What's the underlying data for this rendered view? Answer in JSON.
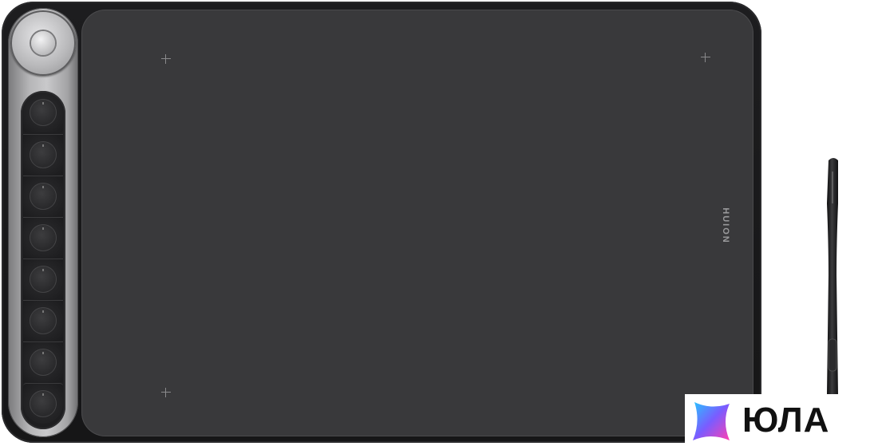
{
  "product": {
    "brand_mark": "HUION",
    "express_keys": 8
  },
  "watermark": {
    "text": "ЮЛА"
  },
  "colors": {
    "tablet_body": "#1d1d1f",
    "active_area": "#39393b",
    "side_panel": "#b5b5b7",
    "watermark_gradient_start": "#27c4ff",
    "watermark_gradient_end": "#ff3fb0"
  },
  "icons": [
    "dial-icon",
    "plus-corner-marker-icon",
    "stylus-pen-icon",
    "yula-star-logo-icon"
  ]
}
